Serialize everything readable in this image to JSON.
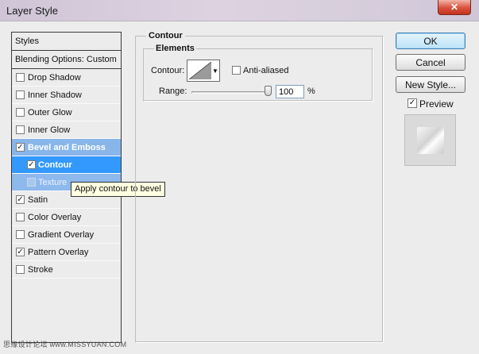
{
  "window": {
    "title": "Layer Style",
    "close_icon": "close-icon"
  },
  "styles_list": {
    "header": "Styles",
    "blending_options": "Blending Options: Custom",
    "items": [
      {
        "label": "Drop Shadow",
        "checked": false
      },
      {
        "label": "Inner Shadow",
        "checked": false
      },
      {
        "label": "Outer Glow",
        "checked": false
      },
      {
        "label": "Inner Glow",
        "checked": false
      },
      {
        "label": "Bevel and Emboss",
        "checked": true
      },
      {
        "label": "Contour",
        "checked": true
      },
      {
        "label": "Texture",
        "checked": false
      },
      {
        "label": "Satin",
        "checked": true
      },
      {
        "label": "Color Overlay",
        "checked": false
      },
      {
        "label": "Gradient Overlay",
        "checked": false
      },
      {
        "label": "Pattern Overlay",
        "checked": true
      },
      {
        "label": "Stroke",
        "checked": false
      }
    ]
  },
  "tooltip": "Apply contour to bevel",
  "contour_panel": {
    "group_title": "Contour",
    "elements_title": "Elements",
    "contour_label": "Contour:",
    "anti_aliased_label": "Anti-aliased",
    "anti_aliased_checked": false,
    "range_label": "Range:",
    "range_value": "100",
    "range_unit": "%",
    "range_slider_fraction": 1.0
  },
  "buttons": {
    "ok": "OK",
    "cancel": "Cancel",
    "new_style": "New Style..."
  },
  "preview": {
    "label": "Preview",
    "checked": true
  },
  "watermark": "思缘设计论坛 www.MISSYUAN.COM",
  "colors": {
    "selection": "#3399ff",
    "selection_light": "#88b6ea",
    "close_button": "#d9503d"
  }
}
